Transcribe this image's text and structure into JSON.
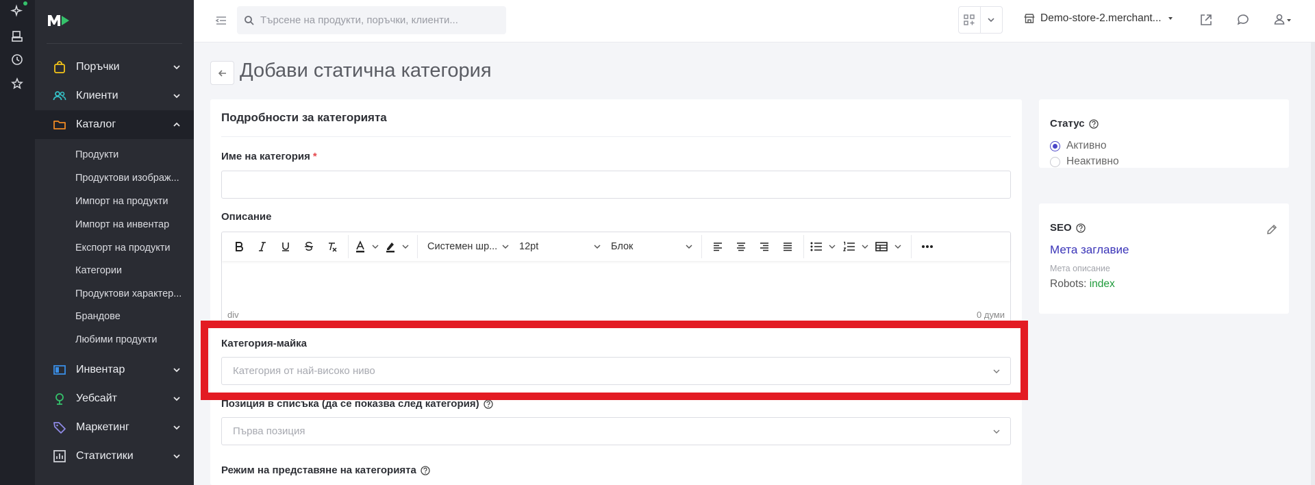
{
  "search": {
    "placeholder": "Търсене на продукти, поръчки, клиенти..."
  },
  "topbar": {
    "store_name": "Demo-store-2.merchant..."
  },
  "sidebar": {
    "items": [
      {
        "label": "Поръчки",
        "icon": "bag-icon",
        "color": "#f5c518"
      },
      {
        "label": "Клиенти",
        "icon": "users-icon",
        "color": "#35c1c7"
      },
      {
        "label": "Каталог",
        "icon": "folder-icon",
        "color": "#f08a24"
      },
      {
        "label": "Инвентар",
        "icon": "inventory-icon",
        "color": "#3a8ee6"
      },
      {
        "label": "Уебсайт",
        "icon": "website-icon",
        "color": "#35c26b"
      },
      {
        "label": "Маркетинг",
        "icon": "tag-icon",
        "color": "#8f8ae6"
      },
      {
        "label": "Статистики",
        "icon": "chart-icon",
        "color": "#cfd1d6"
      }
    ],
    "catalog_sub": [
      "Продукти",
      "Продуктови изображ...",
      "Импорт на продукти",
      "Импорт на инвентар",
      "Експорт на продукти",
      "Категории",
      "Продуктови характер...",
      "Брандове",
      "Любими продукти"
    ]
  },
  "page": {
    "title": "Добави статична категория"
  },
  "form": {
    "card_title": "Подробности за категорията",
    "name_label": "Име на категория",
    "required_mark": "*",
    "description_label": "Описание",
    "editor": {
      "font": "Системен шр...",
      "size": "12pt",
      "block": "Блок",
      "path": "div",
      "words": "0 думи"
    },
    "parent_label": "Категория-майка",
    "parent_placeholder": "Категория от най-високо ниво",
    "position_label": "Позиция в списъка (да се показва след категория)",
    "position_placeholder": "Първа позиция",
    "display_mode_label": "Режим на представяне на категорията"
  },
  "status": {
    "title": "Статус",
    "options": [
      "Активно",
      "Неактивно"
    ],
    "selected": "Активно"
  },
  "seo": {
    "title": "SEO",
    "meta_title": "Мета заглавие",
    "meta_description": "Мета описание",
    "robots_label": "Robots:",
    "robots_value": "index"
  },
  "colors": {
    "accent": "#4b46c8",
    "highlight": "#e31b23",
    "robots_index": "#1e9a3a"
  }
}
